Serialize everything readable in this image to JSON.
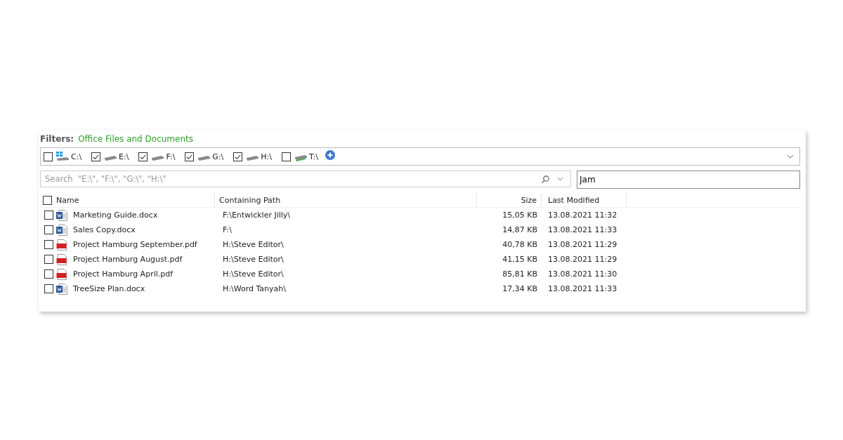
{
  "filters": {
    "label": "Filters:",
    "value": "Office Files and Documents"
  },
  "drives": [
    {
      "label": "C:\\",
      "kind": "windows",
      "checked": false
    },
    {
      "label": "E:\\",
      "kind": "disk",
      "checked": true
    },
    {
      "label": "F:\\",
      "kind": "disk",
      "checked": true
    },
    {
      "label": "G:\\",
      "kind": "disk",
      "checked": true
    },
    {
      "label": "H:\\",
      "kind": "disk",
      "checked": true
    },
    {
      "label": "T:\\",
      "kind": "network",
      "checked": false
    }
  ],
  "search": {
    "placeholder": "Search  \"E:\\\", \"F:\\\", \"G:\\\", \"H:\\\"",
    "query": "Jam"
  },
  "table": {
    "columns": [
      "Name",
      "Containing Path",
      "Size",
      "Last Modified"
    ],
    "all_checked": false,
    "rows": [
      {
        "kind": "docx",
        "checked": false,
        "name": "Marketing Guide.docx",
        "path": "F:\\Entwickler Jilly\\",
        "size": "15,05 KB",
        "modified": "13.08.2021 11:32"
      },
      {
        "kind": "docx",
        "checked": false,
        "name": "Sales Copy.docx",
        "path": "F:\\",
        "size": "14,87 KB",
        "modified": "13.08.2021 11:33"
      },
      {
        "kind": "pdf",
        "checked": false,
        "name": "Project Hamburg September.pdf",
        "path": "H:\\Steve Editor\\",
        "size": "40,78 KB",
        "modified": "13.08.2021 11:29"
      },
      {
        "kind": "pdf",
        "checked": false,
        "name": "Project Hamburg August.pdf",
        "path": "H:\\Steve Editor\\",
        "size": "41,15 KB",
        "modified": "13.08.2021 11:29"
      },
      {
        "kind": "pdf",
        "checked": false,
        "name": "Project Hamburg April.pdf",
        "path": "H:\\Steve Editor\\",
        "size": "85,81 KB",
        "modified": "13.08.2021 11:30"
      },
      {
        "kind": "docx",
        "checked": false,
        "name": "TreeSize Plan.docx",
        "path": "H:\\Word Tanyah\\",
        "size": "17,34 KB",
        "modified": "13.08.2021 11:33"
      }
    ]
  }
}
